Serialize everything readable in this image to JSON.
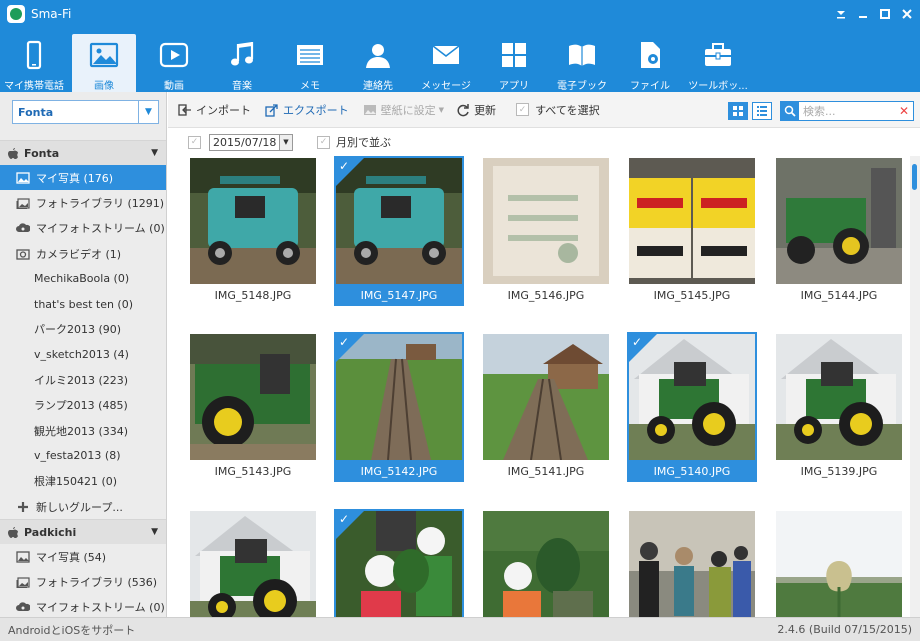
{
  "app": {
    "title": "Sma-Fi"
  },
  "window_controls": [
    "minimize-icon",
    "maximize-icon",
    "close-icon"
  ],
  "toolbar": {
    "active_index": 1,
    "items": [
      {
        "label": "マイ携帯電話",
        "icon": "phone-icon"
      },
      {
        "label": "画像",
        "icon": "image-icon"
      },
      {
        "label": "動画",
        "icon": "video-icon"
      },
      {
        "label": "音楽",
        "icon": "music-icon"
      },
      {
        "label": "メモ",
        "icon": "memo-icon"
      },
      {
        "label": "連絡先",
        "icon": "contact-icon"
      },
      {
        "label": "メッセージ",
        "icon": "message-icon"
      },
      {
        "label": "アプリ",
        "icon": "apps-icon"
      },
      {
        "label": "電子ブック",
        "icon": "ebook-icon"
      },
      {
        "label": "ファイル",
        "icon": "file-icon"
      },
      {
        "label": "ツールボッ...",
        "icon": "toolbox-icon"
      }
    ]
  },
  "sidebar": {
    "device_select": "Fonta",
    "sections": [
      {
        "name": "Fonta",
        "items": [
          {
            "label": "マイ写真 (176)",
            "icon": "photo-icon",
            "active": true,
            "sub": false
          },
          {
            "label": "フォトライブラリ (1291)",
            "icon": "photo-library-icon",
            "active": false,
            "sub": false
          },
          {
            "label": "マイフォトストリーム (0)",
            "icon": "cloud-icon",
            "active": false,
            "sub": false
          },
          {
            "label": "カメラビデオ (1)",
            "icon": "camera-icon",
            "active": false,
            "sub": false
          },
          {
            "label": "MechikaBoola (0)",
            "active": false,
            "sub": true
          },
          {
            "label": "that's best ten (0)",
            "active": false,
            "sub": true
          },
          {
            "label": "パーク2013 (90)",
            "active": false,
            "sub": true
          },
          {
            "label": "v_sketch2013 (4)",
            "active": false,
            "sub": true
          },
          {
            "label": "イルミ2013 (223)",
            "active": false,
            "sub": true
          },
          {
            "label": "ランプ2013 (485)",
            "active": false,
            "sub": true
          },
          {
            "label": "観光地2013 (334)",
            "active": false,
            "sub": true
          },
          {
            "label": "v_festa2013 (8)",
            "active": false,
            "sub": true
          },
          {
            "label": "根津150421 (0)",
            "active": false,
            "sub": true
          },
          {
            "label": "新しいグループ...",
            "icon": "plus-icon",
            "active": false,
            "sub": false
          }
        ]
      },
      {
        "name": "Padkichi",
        "items": [
          {
            "label": "マイ写真 (54)",
            "icon": "photo-icon",
            "active": false,
            "sub": false
          },
          {
            "label": "フォトライブラリ (536)",
            "icon": "photo-library-icon",
            "active": false,
            "sub": false
          },
          {
            "label": "マイフォトストリーム (0)",
            "icon": "cloud-icon",
            "active": false,
            "sub": false
          }
        ]
      }
    ]
  },
  "actions": {
    "import": "インポート",
    "export": "エクスポート",
    "wallpaper": "壁紙に設定",
    "refresh": "更新",
    "select_all": "すべてを選択",
    "search_placeholder": "検索..."
  },
  "filter": {
    "date": "2015/07/18",
    "group_by_month": "月別で並ぶ"
  },
  "photos": [
    {
      "name": "IMG_5148.JPG",
      "selected": false,
      "scene": "cart"
    },
    {
      "name": "IMG_5147.JPG",
      "selected": true,
      "scene": "cart"
    },
    {
      "name": "IMG_5146.JPG",
      "selected": false,
      "scene": "sign"
    },
    {
      "name": "IMG_5145.JPG",
      "selected": false,
      "scene": "boxes"
    },
    {
      "name": "IMG_5144.JPG",
      "selected": false,
      "scene": "tractor-shed"
    },
    {
      "name": "IMG_5143.JPG",
      "selected": false,
      "scene": "tractor-close"
    },
    {
      "name": "IMG_5142.JPG",
      "selected": true,
      "scene": "path"
    },
    {
      "name": "IMG_5141.JPG",
      "selected": false,
      "scene": "path-house"
    },
    {
      "name": "IMG_5140.JPG",
      "selected": true,
      "scene": "tractor-barn"
    },
    {
      "name": "IMG_5139.JPG",
      "selected": false,
      "scene": "tractor-barn"
    },
    {
      "name": "",
      "selected": false,
      "scene": "tractor-barn"
    },
    {
      "name": "",
      "selected": true,
      "scene": "kids"
    },
    {
      "name": "",
      "selected": false,
      "scene": "kids-leaf"
    },
    {
      "name": "",
      "selected": false,
      "scene": "crowd"
    },
    {
      "name": "",
      "selected": false,
      "scene": "lotus"
    }
  ],
  "status": {
    "left": "AndroidとiOSをサポート",
    "right": "2.4.6 (Build 07/15/2015)"
  }
}
